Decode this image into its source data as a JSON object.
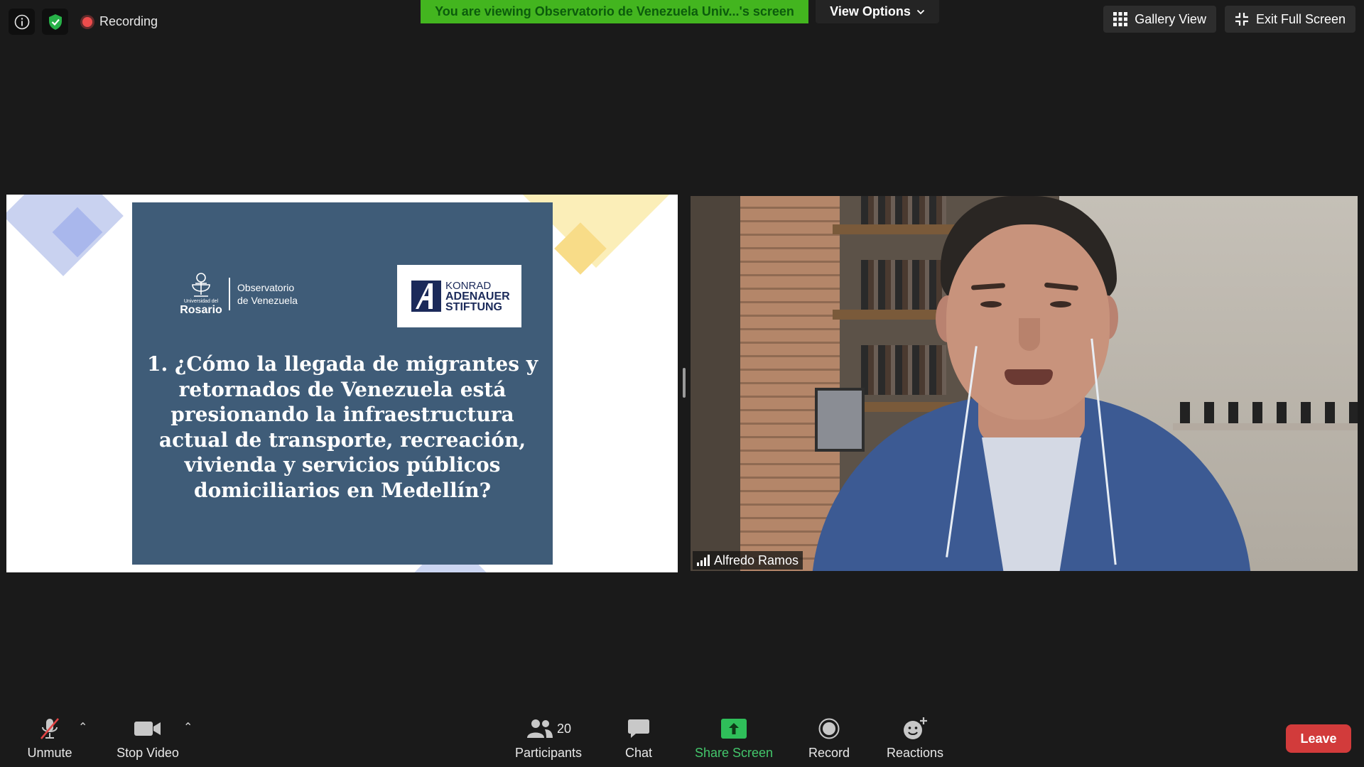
{
  "top_left": {
    "recording_label": "Recording"
  },
  "banner": {
    "viewing_text": "You are viewing Observatorio de Venezuela Univ...'s screen",
    "view_options_label": "View Options"
  },
  "top_right": {
    "gallery_view_label": "Gallery View",
    "exit_full_screen_label": "Exit Full Screen"
  },
  "shared_slide": {
    "logo_univ_small": "Universidad del",
    "logo_univ_name": "Rosario",
    "logo_observatorio_line1": "Observatorio",
    "logo_observatorio_line2": "de Venezuela",
    "logo_kas_line1": "KONRAD",
    "logo_kas_line2": "ADENAUER",
    "logo_kas_line3": "STIFTUNG",
    "question": "1. ¿Cómo la llegada de migrantes y retornados de Venezuela está presionando la infraestructura actual de transporte, recreación, vivienda y servicios públicos domiciliarios en Medellín?"
  },
  "video": {
    "participant_name": "Alfredo Ramos"
  },
  "toolbar": {
    "unmute_label": "Unmute",
    "stop_video_label": "Stop Video",
    "participants_label": "Participants",
    "participants_count": "20",
    "chat_label": "Chat",
    "share_screen_label": "Share Screen",
    "record_label": "Record",
    "reactions_label": "Reactions",
    "leave_label": "Leave"
  },
  "colors": {
    "banner_green": "#43b51f",
    "share_green": "#43c66b",
    "leave_red": "#d23b3b",
    "slide_blue": "#3f5c78"
  }
}
